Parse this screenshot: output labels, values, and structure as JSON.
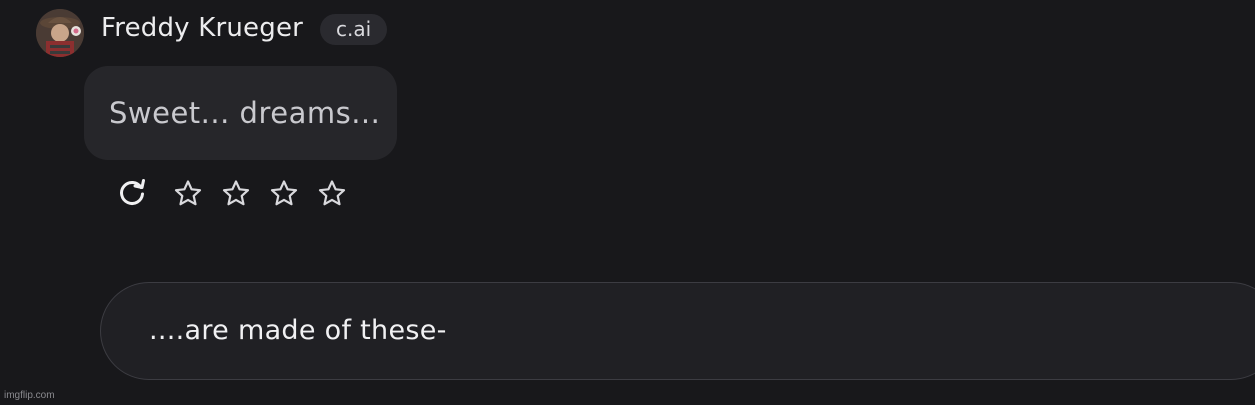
{
  "message": {
    "author": "Freddy Krueger",
    "badge": "c.ai",
    "avatar_icon": "character-avatar-icon",
    "text": "Sweet... dreams..."
  },
  "actions": {
    "regenerate_icon": "refresh-icon",
    "rating_icon": "star-outline-icon",
    "rating_stars_total": 4,
    "rating_value": 0
  },
  "composer": {
    "value": "....are made of these-"
  },
  "watermark": "imgflip.com",
  "colors": {
    "background": "#18181b",
    "bubble": "#26262a",
    "badge": "#2a2a2f",
    "input": "#202024"
  }
}
